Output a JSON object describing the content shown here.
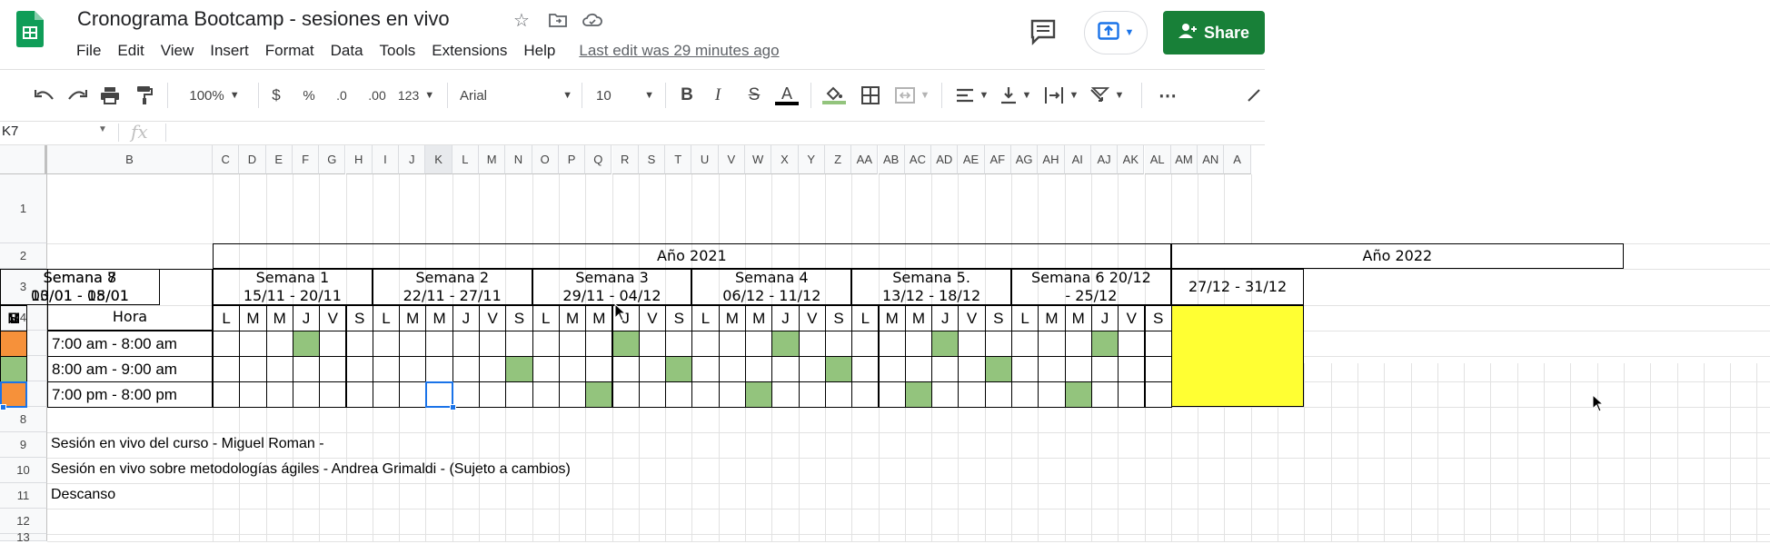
{
  "app": {
    "title": "Cronograma Bootcamp - sesiones en vivo",
    "menu": [
      "File",
      "Edit",
      "View",
      "Insert",
      "Format",
      "Data",
      "Tools",
      "Extensions",
      "Help"
    ],
    "last_edit": "Last edit was 29 minutes ago",
    "share_label": "Share",
    "brand_color": "#188038"
  },
  "toolbar": {
    "zoom": "100%",
    "currency": "$",
    "percent": "%",
    "dec_decrease": ".0",
    "dec_increase": ".00",
    "format_more": "123",
    "font": "Arial",
    "font_size": "10",
    "bold": "B",
    "italic": "I",
    "strike": "S",
    "text_color": "A",
    "more": "⋯"
  },
  "formula_bar": {
    "name_box": "K7",
    "fx": "fx",
    "value": ""
  },
  "columns": [
    "B",
    "C",
    "D",
    "E",
    "F",
    "G",
    "H",
    "I",
    "J",
    "K",
    "L",
    "M",
    "N",
    "O",
    "P",
    "Q",
    "R",
    "S",
    "T",
    "U",
    "V",
    "W",
    "X",
    "Y",
    "Z",
    "AA",
    "AB",
    "AC",
    "AD",
    "AE",
    "AF",
    "AG",
    "AH",
    "AI",
    "AJ",
    "AK",
    "AL",
    "AM",
    "AN",
    "A"
  ],
  "rows": [
    "1",
    "2",
    "3",
    "4",
    "5",
    "6",
    "7",
    "8",
    "9",
    "10",
    "11",
    "12",
    "13"
  ],
  "sheet": {
    "year1": "Año 2021",
    "year2": "Año 2022",
    "hora": "Hora",
    "weeks": [
      {
        "l1": "Semana 1",
        "l2": "15/11 - 20/11"
      },
      {
        "l1": "Semana 2",
        "l2": "22/11 - 27/11"
      },
      {
        "l1": "Semana 3",
        "l2": "29/11 - 04/12"
      },
      {
        "l1": "Semana 4",
        "l2": "06/12 - 11/12"
      },
      {
        "l1": "Semana 5.",
        "l2": "13/12 - 18/12"
      },
      {
        "l1": "Semana 6      20/12",
        "l2": "- 25/12"
      },
      {
        "l1": "",
        "l2": "27/12 - 31/12"
      },
      {
        "l1": "Semana 7",
        "l2": "03/01 - 08/01"
      },
      {
        "l1": "Semana 8",
        "l2": "10/01 - 15/01"
      }
    ],
    "days": [
      "L",
      "M",
      "M",
      "J",
      "V",
      "S"
    ],
    "hours": [
      "7:00 am - 8:00 am",
      "8:00 am - 9:00 am",
      "7:00 pm - 8:00 pm"
    ],
    "legend": [
      "Sesión en vivo del curso - Miguel Roman -",
      "Sesión en vivo sobre metodologías ágiles - Andrea Grimaldi - (Sujeto a cambios)",
      "Descanso"
    ],
    "colors": {
      "green": "#93c47d",
      "dark_green": "#6aa84f",
      "orange": "#f6913a",
      "yellow": "#ffff33",
      "selection": "#1a73e8"
    },
    "schedule": {
      "row5": {
        "green": [
          [
            0,
            3
          ],
          [
            2,
            3
          ],
          [
            3,
            3
          ],
          [
            4,
            3
          ],
          [
            5,
            3
          ],
          [
            7,
            3
          ]
        ],
        "dark_green": [
          [
            8,
            3
          ]
        ],
        "orange": [
          [
            8,
            5
          ]
        ]
      },
      "row6": {
        "green": [
          [
            1,
            5
          ],
          [
            2,
            5
          ],
          [
            3,
            5
          ],
          [
            4,
            5
          ],
          [
            7,
            5
          ],
          [
            8,
            5
          ]
        ]
      },
      "row7": {
        "green": [
          [
            2,
            2
          ],
          [
            3,
            2
          ],
          [
            4,
            2
          ],
          [
            5,
            2
          ],
          [
            7,
            2
          ],
          [
            8,
            2
          ]
        ],
        "orange": [
          [
            7,
            3
          ],
          [
            7,
            4
          ],
          [
            8,
            3
          ],
          [
            8,
            4
          ]
        ],
        "selected": [
          1,
          2
        ]
      }
    }
  }
}
